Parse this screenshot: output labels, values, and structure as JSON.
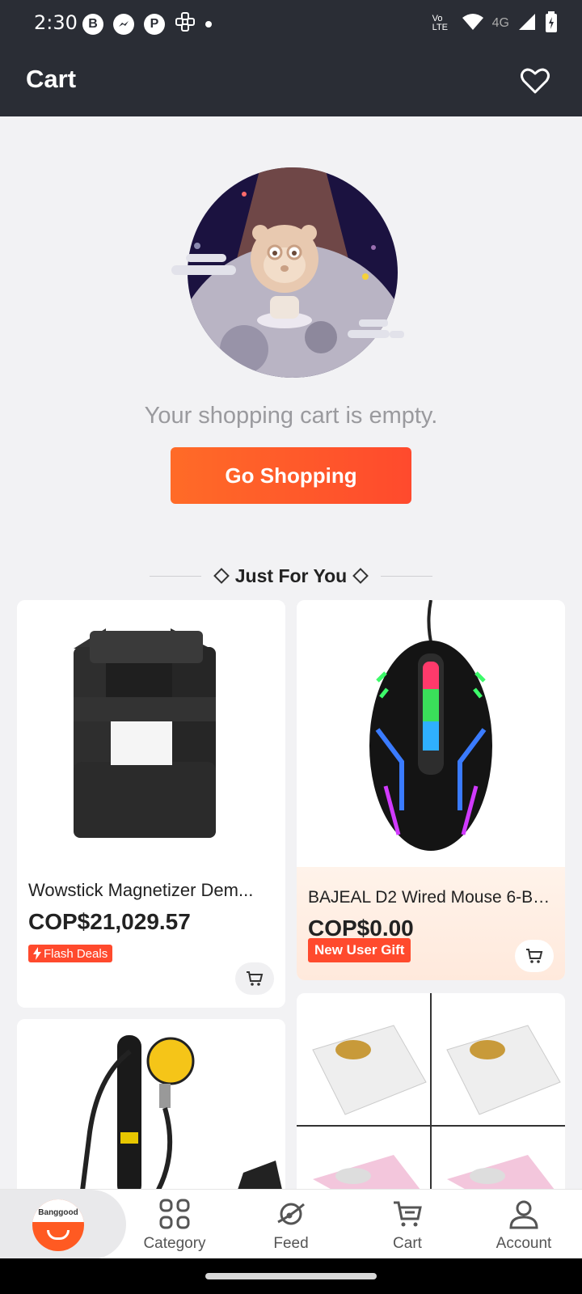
{
  "status_bar": {
    "time": "2:30",
    "network": "4G",
    "volte": "Vo LTE"
  },
  "app_bar": {
    "title": "Cart"
  },
  "empty_cart": {
    "message": "Your shopping cart is empty.",
    "button_label": "Go Shopping"
  },
  "section": {
    "title": "Just For You"
  },
  "products": [
    {
      "name": "Wowstick Magnetizer Dem...",
      "price": "COP$21,029.57",
      "badge": "Flash Deals"
    },
    {
      "name": "BAJEAL D2 Wired Mouse 6-Bu...",
      "price": "COP$0.00",
      "badge": "New User Gift"
    }
  ],
  "bottom_nav": {
    "home_logo_text": "Banggood",
    "items": [
      {
        "label": "Category"
      },
      {
        "label": "Feed"
      },
      {
        "label": "Cart"
      },
      {
        "label": "Account"
      }
    ]
  },
  "colors": {
    "accent": "#ff5a22",
    "header": "#2a2d35",
    "background": "#f2f2f4"
  }
}
